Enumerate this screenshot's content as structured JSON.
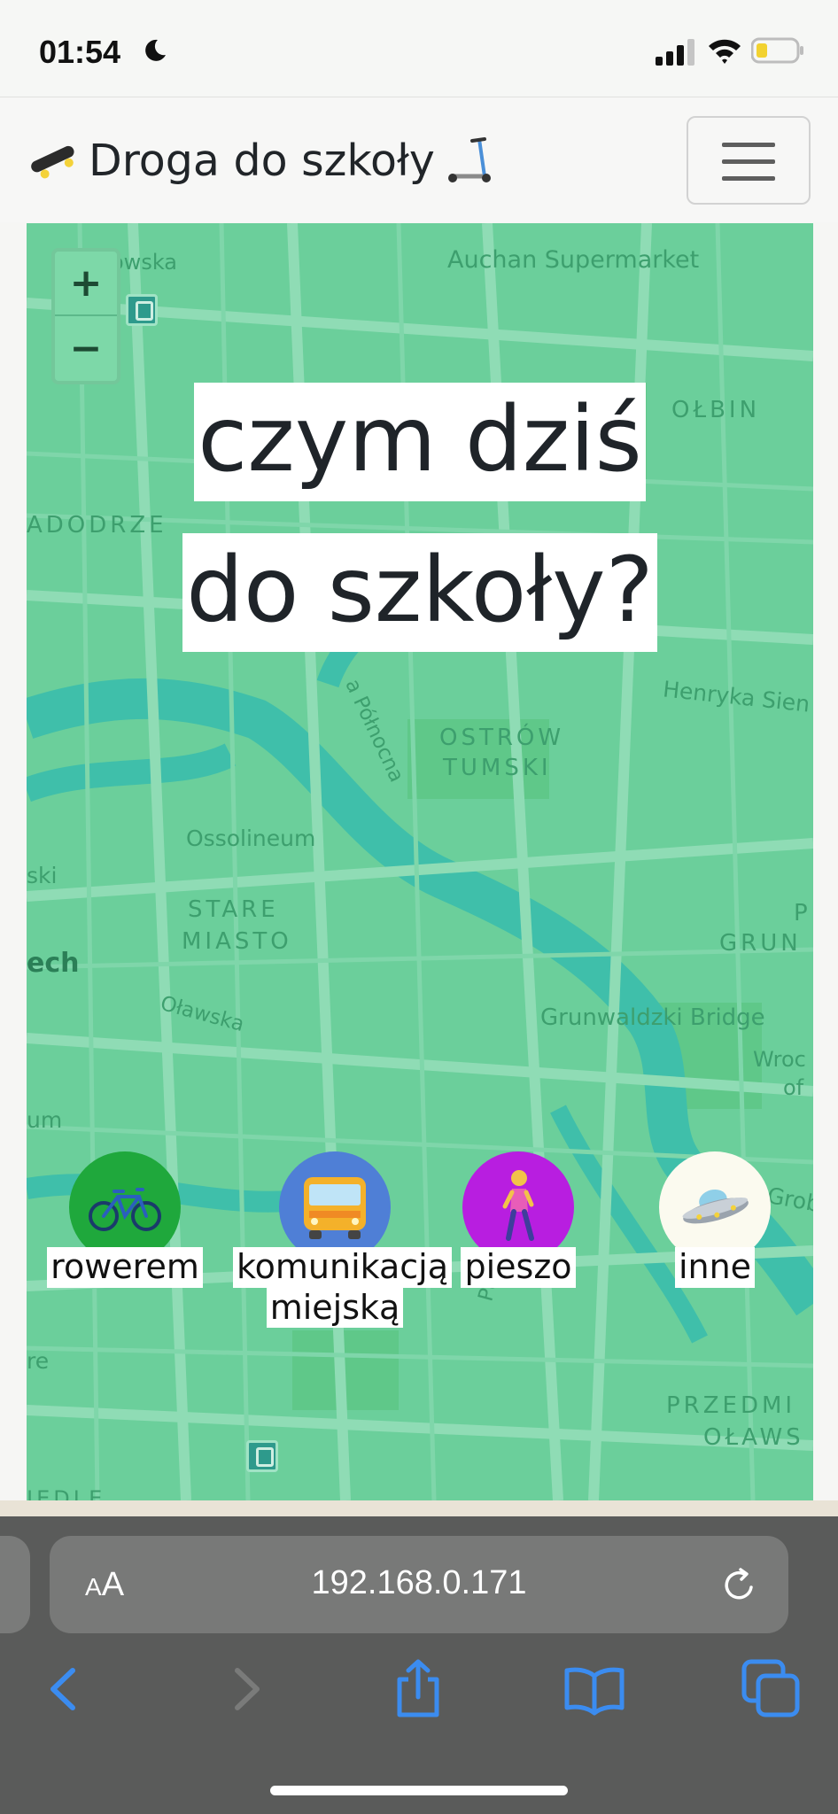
{
  "status_bar": {
    "time": "01:54",
    "icons": [
      "moon-icon",
      "cellular-signal-icon",
      "wifi-icon",
      "battery-low-icon"
    ],
    "battery_color": "#f2d230"
  },
  "navbar": {
    "brand_left_emoji": "skateboard",
    "title": "Droga do szkoły",
    "brand_right_emoji": "kick-scooter",
    "menu_icon": "hamburger-icon"
  },
  "map": {
    "zoom_in": "+",
    "zoom_out": "−",
    "labels": {
      "street_owska": "owska",
      "auchan": "Auchan Supermarket",
      "olbin": "OŁBIN",
      "nadodrze": "ADODRZE",
      "henryka": "Henryka Sien",
      "polnocna": "a Północna",
      "ostrow": "OSTRÓW",
      "tumski": "TUMSKI",
      "ossolineum": "Ossolineum",
      "ski": "ski",
      "stare": "STARE",
      "miasto": "MIASTO",
      "ech": "ech",
      "olawska": "Oławska",
      "grunwaldzki": "Grunwaldzki Bridge",
      "p": "P",
      "grun": "GRUN",
      "wroc": "Wroc",
      "of": "of",
      "um": "um",
      "grob": "Grob",
      "puta": "Puła",
      "re": "re",
      "przedmi": "PRZEDMI",
      "olaws": "OŁAWS",
      "iedle": "IEDLE"
    },
    "colors": {
      "base": "#6bcf9b",
      "water": "#3fbfaa",
      "roads": "#8fdcb5"
    }
  },
  "hero": {
    "line1": "czym dziś",
    "line2": "do szkoły?"
  },
  "modes": [
    {
      "label": "rowerem",
      "emoji": "bicycle",
      "color": "#1fa83c"
    },
    {
      "label_line1": "komunikacją",
      "label_line2": "miejską",
      "emoji": "bus",
      "color": "#4f7fd6"
    },
    {
      "label": "pieszo",
      "emoji": "woman-walking",
      "color": "#b81ee0"
    },
    {
      "label": "inne",
      "emoji": "flying-saucer",
      "color": "#fbfaef"
    }
  ],
  "browser": {
    "aa_small": "A",
    "aa_large": "A",
    "url": "192.168.0.171",
    "icons": [
      "text-size-icon",
      "reload-icon",
      "back-icon",
      "forward-icon",
      "share-icon",
      "bookmarks-icon",
      "tabs-icon"
    ]
  }
}
